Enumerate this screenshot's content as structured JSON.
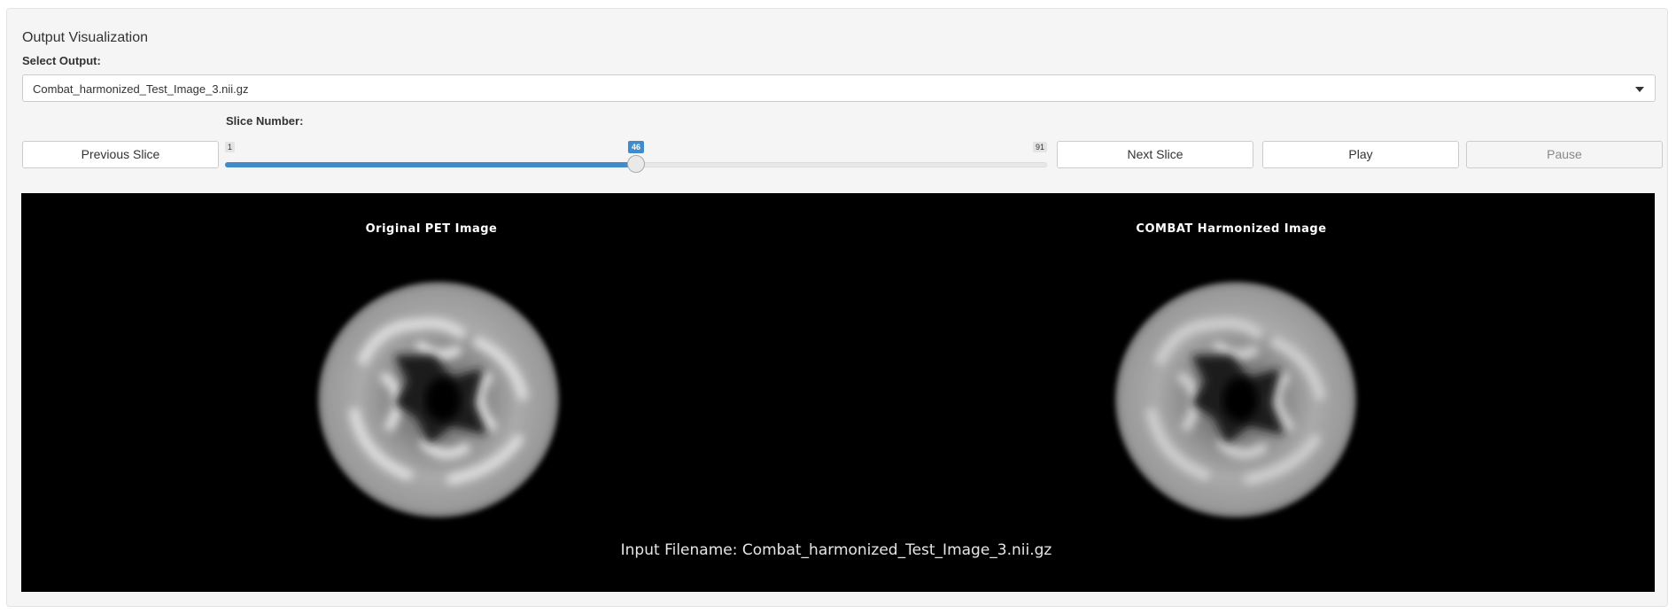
{
  "panel": {
    "title": "Output Visualization"
  },
  "output_select": {
    "label": "Select Output:",
    "value": "Combat_harmonized_Test_Image_3.nii.gz"
  },
  "slider": {
    "label": "Slice Number:",
    "min": 1,
    "max": 91,
    "value": 46
  },
  "buttons": {
    "previous": "Previous Slice",
    "next": "Next Slice",
    "play": "Play",
    "pause": "Pause"
  },
  "viewer": {
    "left_title": "Original PET Image",
    "right_title": "COMBAT Harmonized Image",
    "filename": "Input Filename: Combat_harmonized_Test_Image_3.nii.gz"
  }
}
